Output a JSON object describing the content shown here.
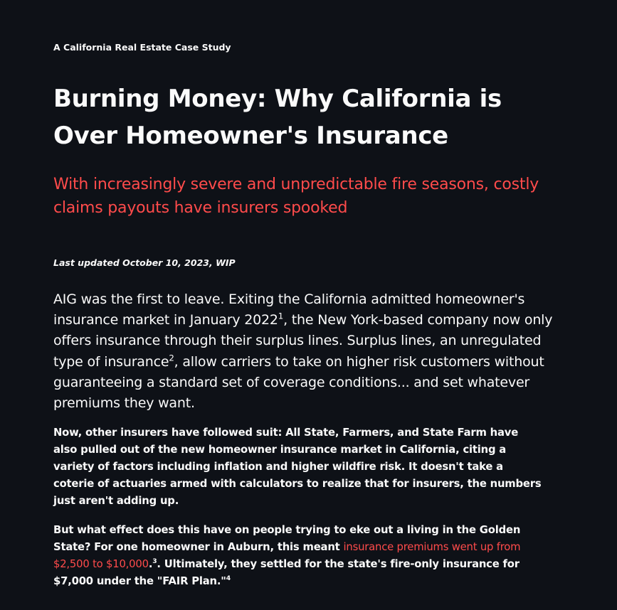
{
  "kicker": "A California Real Estate Case Study",
  "title": "Burning Money: Why California is Over Homeowner's Insurance",
  "subtitle": "With increasingly severe and unpredictable fire seasons, costly claims payouts have insurers spooked",
  "updated": "Last updated October 10, 2023, WIP",
  "lead": {
    "part1": "AIG was the first to leave. Exiting the California admitted homeowner's insurance market in January 2022",
    "fn1": "1",
    "part2": ", the New York-based company now only offers insurance through their surplus lines. Surplus lines, an unregulated type of insurance",
    "fn2": "2",
    "part3": ", allow carriers to take on higher risk customers without guaranteeing a standard set of coverage conditions... and set whatever premiums they want."
  },
  "para1": "Now, other insurers have followed suit: All State, Farmers, and State Farm have also pulled out of the new homeowner insurance market in California, citing a variety of factors including inflation and higher wildfire risk. It doesn't take a coterie of actuaries armed with calculators to realize that for insurers, the numbers just aren't adding up.",
  "para2": {
    "part1": "But what effect does this have on people trying to eke out a living in the Golden State? For one homeowner in Auburn, this meant ",
    "link": "insurance premiums went up from $2,500 to $10,000",
    "part2": ".",
    "fn3": "3",
    "part3": ". Ultimately, they settled for the state's fire-only insurance for $7,000 under the \"FAIR Plan.\"",
    "fn4": "4"
  },
  "colors": {
    "background": "#0e1117",
    "text": "#fafafa",
    "accent": "#ff4b4b"
  }
}
